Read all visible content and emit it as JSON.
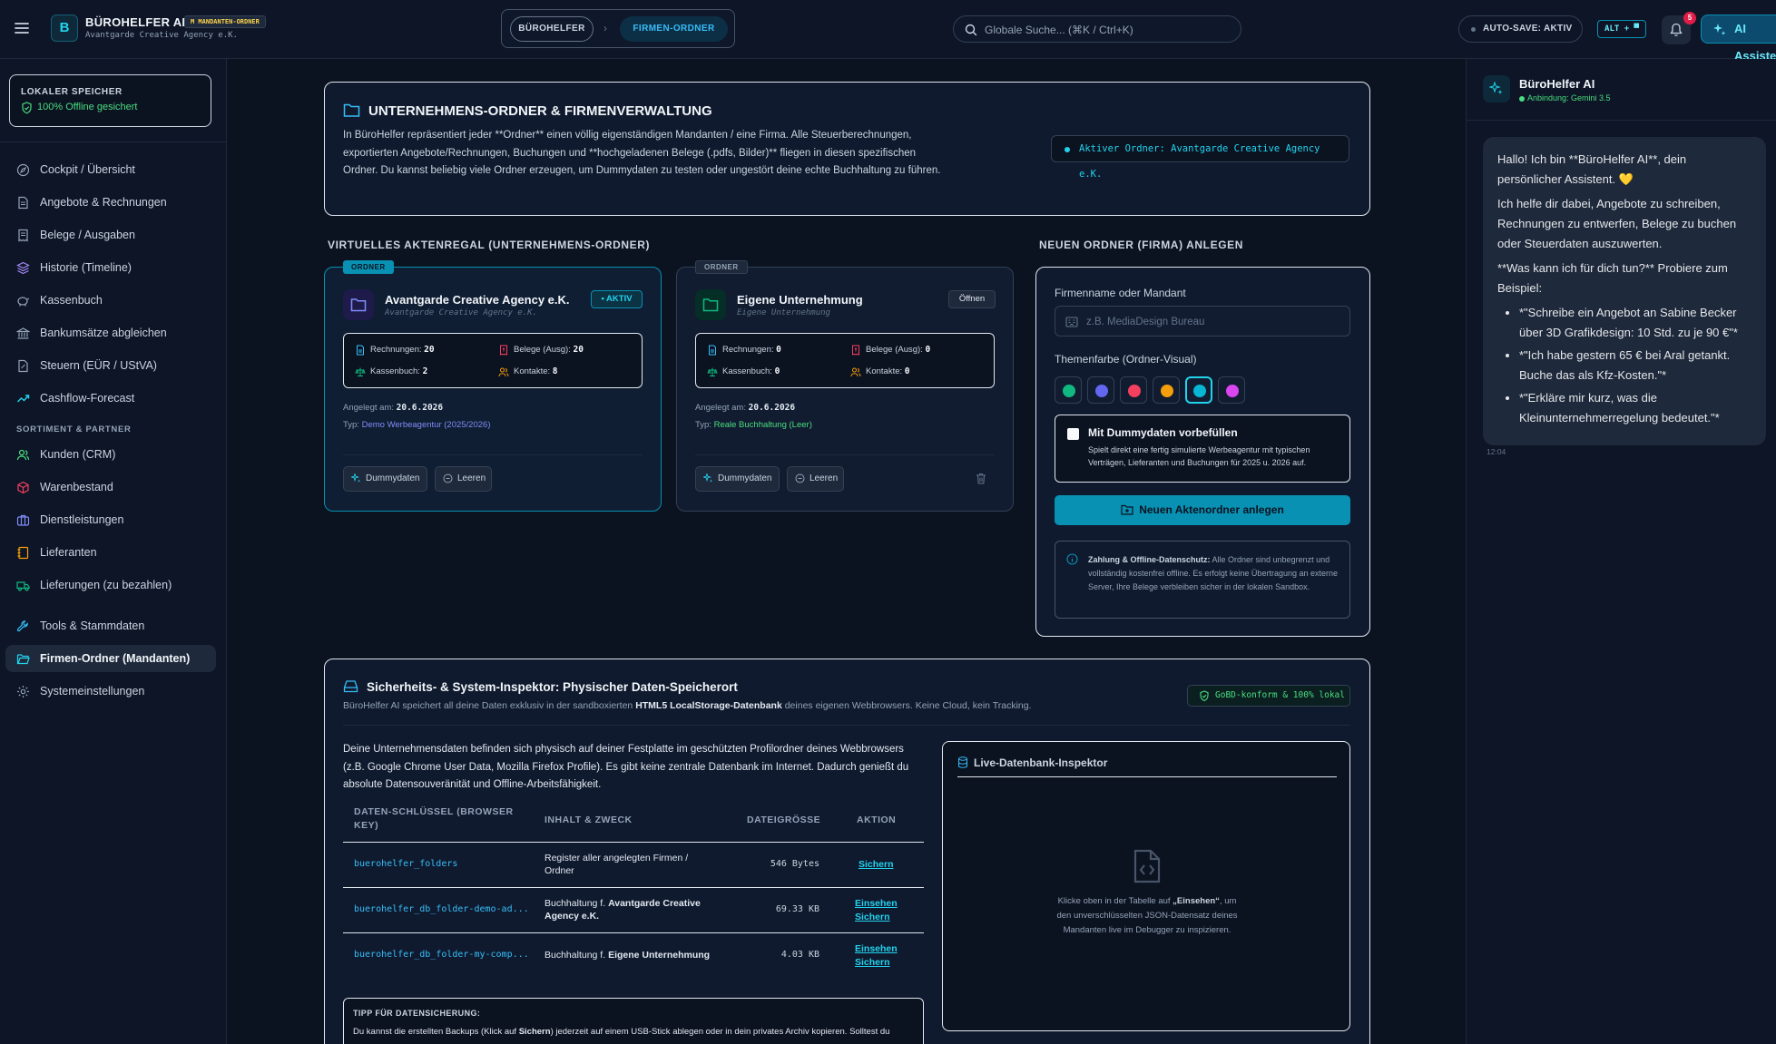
{
  "topbar": {
    "app_logo_letter": "B",
    "app_title": "BÜROHELFER AI",
    "app_badge": "M MANDANTEN-ORDNER",
    "app_subtitle": "Avantgarde Creative Agency e.K.",
    "breadcrumb": [
      "BÜROHELFER",
      "FIRMEN-ORDNER"
    ],
    "search_placeholder": "Globale Suche... (⌘K / Ctrl+K)",
    "autosave_label": "AUTO-SAVE: AKTIV",
    "alt_shortcut": "ALT + ▀",
    "notification_count": "5",
    "ai_button_label": "AI Assiste"
  },
  "sidebar": {
    "storage_title": "LOKALER SPEICHER",
    "storage_status": "100% Offline gesichert",
    "items": [
      {
        "label": "Cockpit / Übersicht",
        "icon": "compass-icon"
      },
      {
        "label": "Angebote & Rechnungen",
        "icon": "document-icon"
      },
      {
        "label": "Belege / Ausgaben",
        "icon": "receipt-icon"
      },
      {
        "label": "Historie (Timeline)",
        "icon": "layers-icon"
      },
      {
        "label": "Kassenbuch",
        "icon": "piggy-bank-icon"
      },
      {
        "label": "Bankumsätze abgleichen",
        "icon": "bank-icon"
      },
      {
        "label": "Steuern (EÜR / UStVA)",
        "icon": "tax-document-icon"
      },
      {
        "label": "Cashflow-Forecast",
        "icon": "trend-up-icon"
      }
    ],
    "section_label": "SORTIMENT & PARTNER",
    "items2": [
      {
        "label": "Kunden (CRM)",
        "icon": "users-icon"
      },
      {
        "label": "Warenbestand",
        "icon": "box-icon"
      },
      {
        "label": "Dienstleistungen",
        "icon": "briefcase-icon"
      },
      {
        "label": "Lieferanten",
        "icon": "notebook-icon"
      },
      {
        "label": "Lieferungen (zu bezahlen)",
        "icon": "truck-icon"
      }
    ],
    "items3": [
      {
        "label": "Tools & Stammdaten",
        "icon": "wrench-icon"
      },
      {
        "label": "Firmen-Ordner (Mandanten)",
        "icon": "folder-open-icon",
        "active": true
      },
      {
        "label": "Systemeinstellungen",
        "icon": "gear-icon"
      }
    ]
  },
  "header": {
    "title": "UNTERNEHMENS-ORDNER & FIRMENVERWALTUNG",
    "description": "In BüroHelfer repräsentiert jeder **Ordner** einen völlig eigenständigen Mandanten / eine Firma. Alle Steuerberechnungen, exportierten Angebote/Rechnungen, Buchungen und **hochgeladenen Belege (.pdfs, Bilder)** fliegen in diesen spezifischen Ordner. Du kannst beliebig viele Ordner erzeugen, um Dummydaten zu testen oder ungestört deine echte Buchhaltung zu führen.",
    "active_folder": "Aktiver Ordner: Avantgarde Creative Agency e.K."
  },
  "shelf": {
    "title": "VIRTUELLES AKTENREGAL (UNTERNEHMENS-ORDNER)",
    "folders": [
      {
        "tag": "ORDNER",
        "name": "Avantgarde Creative Agency e.K.",
        "subtitle": "Avantgarde Creative Agency e.K.",
        "status": "• AKTIV",
        "stats": {
          "rechnungen_label": "Rechnungen:",
          "rechnungen": "20",
          "belege_label": "Belege (Ausg):",
          "belege": "20",
          "kassenbuch_label": "Kassenbuch:",
          "kassenbuch": "2",
          "kontakte_label": "Kontakte:",
          "kontakte": "8"
        },
        "created_label": "Angelegt am:",
        "created": "20.6.2026",
        "type_label": "Typ:",
        "type": "Demo Werbeagentur (2025/2026)",
        "btn_dummy": "Dummydaten",
        "btn_clear": "Leeren"
      },
      {
        "tag": "ORDNER",
        "name": "Eigene Unternehmung",
        "subtitle": "Eigene Unternehmung",
        "status": "Öffnen",
        "stats": {
          "rechnungen_label": "Rechnungen:",
          "rechnungen": "0",
          "belege_label": "Belege (Ausg):",
          "belege": "0",
          "kassenbuch_label": "Kassenbuch:",
          "kassenbuch": "0",
          "kontakte_label": "Kontakte:",
          "kontakte": "0"
        },
        "created_label": "Angelegt am:",
        "created": "20.6.2026",
        "type_label": "Typ:",
        "type": "Reale Buchhaltung (Leer)",
        "btn_dummy": "Dummydaten",
        "btn_clear": "Leeren"
      }
    ]
  },
  "new_folder": {
    "title": "NEUEN ORDNER (FIRMA) ANLEGEN",
    "name_label": "Firmenname oder Mandant",
    "name_placeholder": "z.B. MediaDesign Bureau",
    "color_label": "Themenfarbe (Ordner-Visual)",
    "colors": [
      "#10b981",
      "#6366f1",
      "#f43f5e",
      "#f59e0b",
      "#06b6d4",
      "#d946ef"
    ],
    "selected_color": "#06b6d4",
    "dummy_title": "Mit Dummydaten vorbefüllen",
    "dummy_desc": "Spielt direkt eine fertig simulierte Werbeagentur mit typischen Verträgen, Lieferanten und Buchungen für 2025 u. 2026 auf.",
    "create_btn": "Neuen Aktenordner anlegen",
    "info_title": "Zahlung & Offline-Datenschutz:",
    "info_text": "Alle Ordner sind unbegrenzt und vollständig kostenfrei offline. Es erfolgt keine Übertragung an externe Server, Ihre Belege verbleiben sicher in der lokalen Sandbox."
  },
  "inspector": {
    "title": "Sicherheits- & System-Inspektor: Physischer Daten-Speicherort",
    "subtitle_pre": "BüroHelfer AI speichert all deine Daten exklusiv in der sandboxierten",
    "subtitle_bold": "HTML5 LocalStorage-Datenbank",
    "subtitle_post": "deines eigenen Webbrowsers. Keine Cloud, kein Tracking.",
    "gobd": "GoBD-konform & 100% lokal",
    "description": "Deine Unternehmensdaten befinden sich physisch auf deiner Festplatte im geschützten Profilordner deines Webbrowsers (z.B. Google Chrome User Data, Mozilla Firefox Profile). Es gibt keine zentrale Datenbank im Internet. Dadurch genießt du absolute Datensouveränität und Offline-Arbeitsfähigkeit.",
    "columns": [
      "DATEN-SCHLÜSSEL (BROWSER KEY)",
      "INHALT & ZWECK",
      "DATEIGRÖSSE",
      "AKTION"
    ],
    "rows": [
      {
        "key": "buerohelfer_folders",
        "content": "Register aller angelegten Firmen / Ordner",
        "content_bold": "",
        "size": "546 Bytes",
        "actions": [
          "Sichern"
        ]
      },
      {
        "key": "buerohelfer_db_folder-demo-ad...",
        "content": "Buchhaltung f.",
        "content_bold": "Avantgarde Creative Agency e.K.",
        "size": "69.33 KB",
        "actions": [
          "Einsehen",
          "Sichern"
        ]
      },
      {
        "key": "buerohelfer_db_folder-my-comp...",
        "content": "Buchhaltung f.",
        "content_bold": "Eigene Unternehmung",
        "size": "4.03 KB",
        "actions": [
          "Einsehen",
          "Sichern"
        ]
      }
    ],
    "tip_title": "TIPP FÜR DATENSICHERUNG:",
    "tip_pre": "Du kannst die erstellten Backups (Klick auf",
    "tip_bold": "Sichern",
    "tip_post": ") jederzeit auf einem USB-Stick ablegen oder in dein privates Archiv kopieren. Solltest du",
    "live_title": "Live-Datenbank-Inspektor",
    "live_pre": "Klicke oben in der Tabelle auf",
    "live_bold": "„Einsehen“",
    "live_post": ", um den unverschlüsselten JSON-Datensatz deines Mandanten live im Debugger zu inspizieren."
  },
  "ai": {
    "name": "BüroHelfer AI",
    "model": "Anbindung: Gemini 3.5",
    "msg1": "Hallo! Ich bin **BüroHelfer AI**, dein persönlicher Assistent. 💛",
    "msg2": "Ich helfe dir dabei, Angebote zu schreiben, Rechnungen zu entwerfen, Belege zu buchen oder Steuerdaten auszuwerten.",
    "msg3": "**Was kann ich für dich tun?** Probiere zum Beispiel:",
    "examples": [
      "*\"Schreibe ein Angebot an Sabine Becker über 3D Grafikdesign: 10 Std. zu je 90 €\"*",
      "*\"Ich habe gestern 65 € bei Aral getankt. Buche das als Kfz-Kosten.\"*",
      "*\"Erkläre mir kurz, was die Kleinunternehmerregelung bedeutet.\"*"
    ],
    "time": "12:04"
  }
}
